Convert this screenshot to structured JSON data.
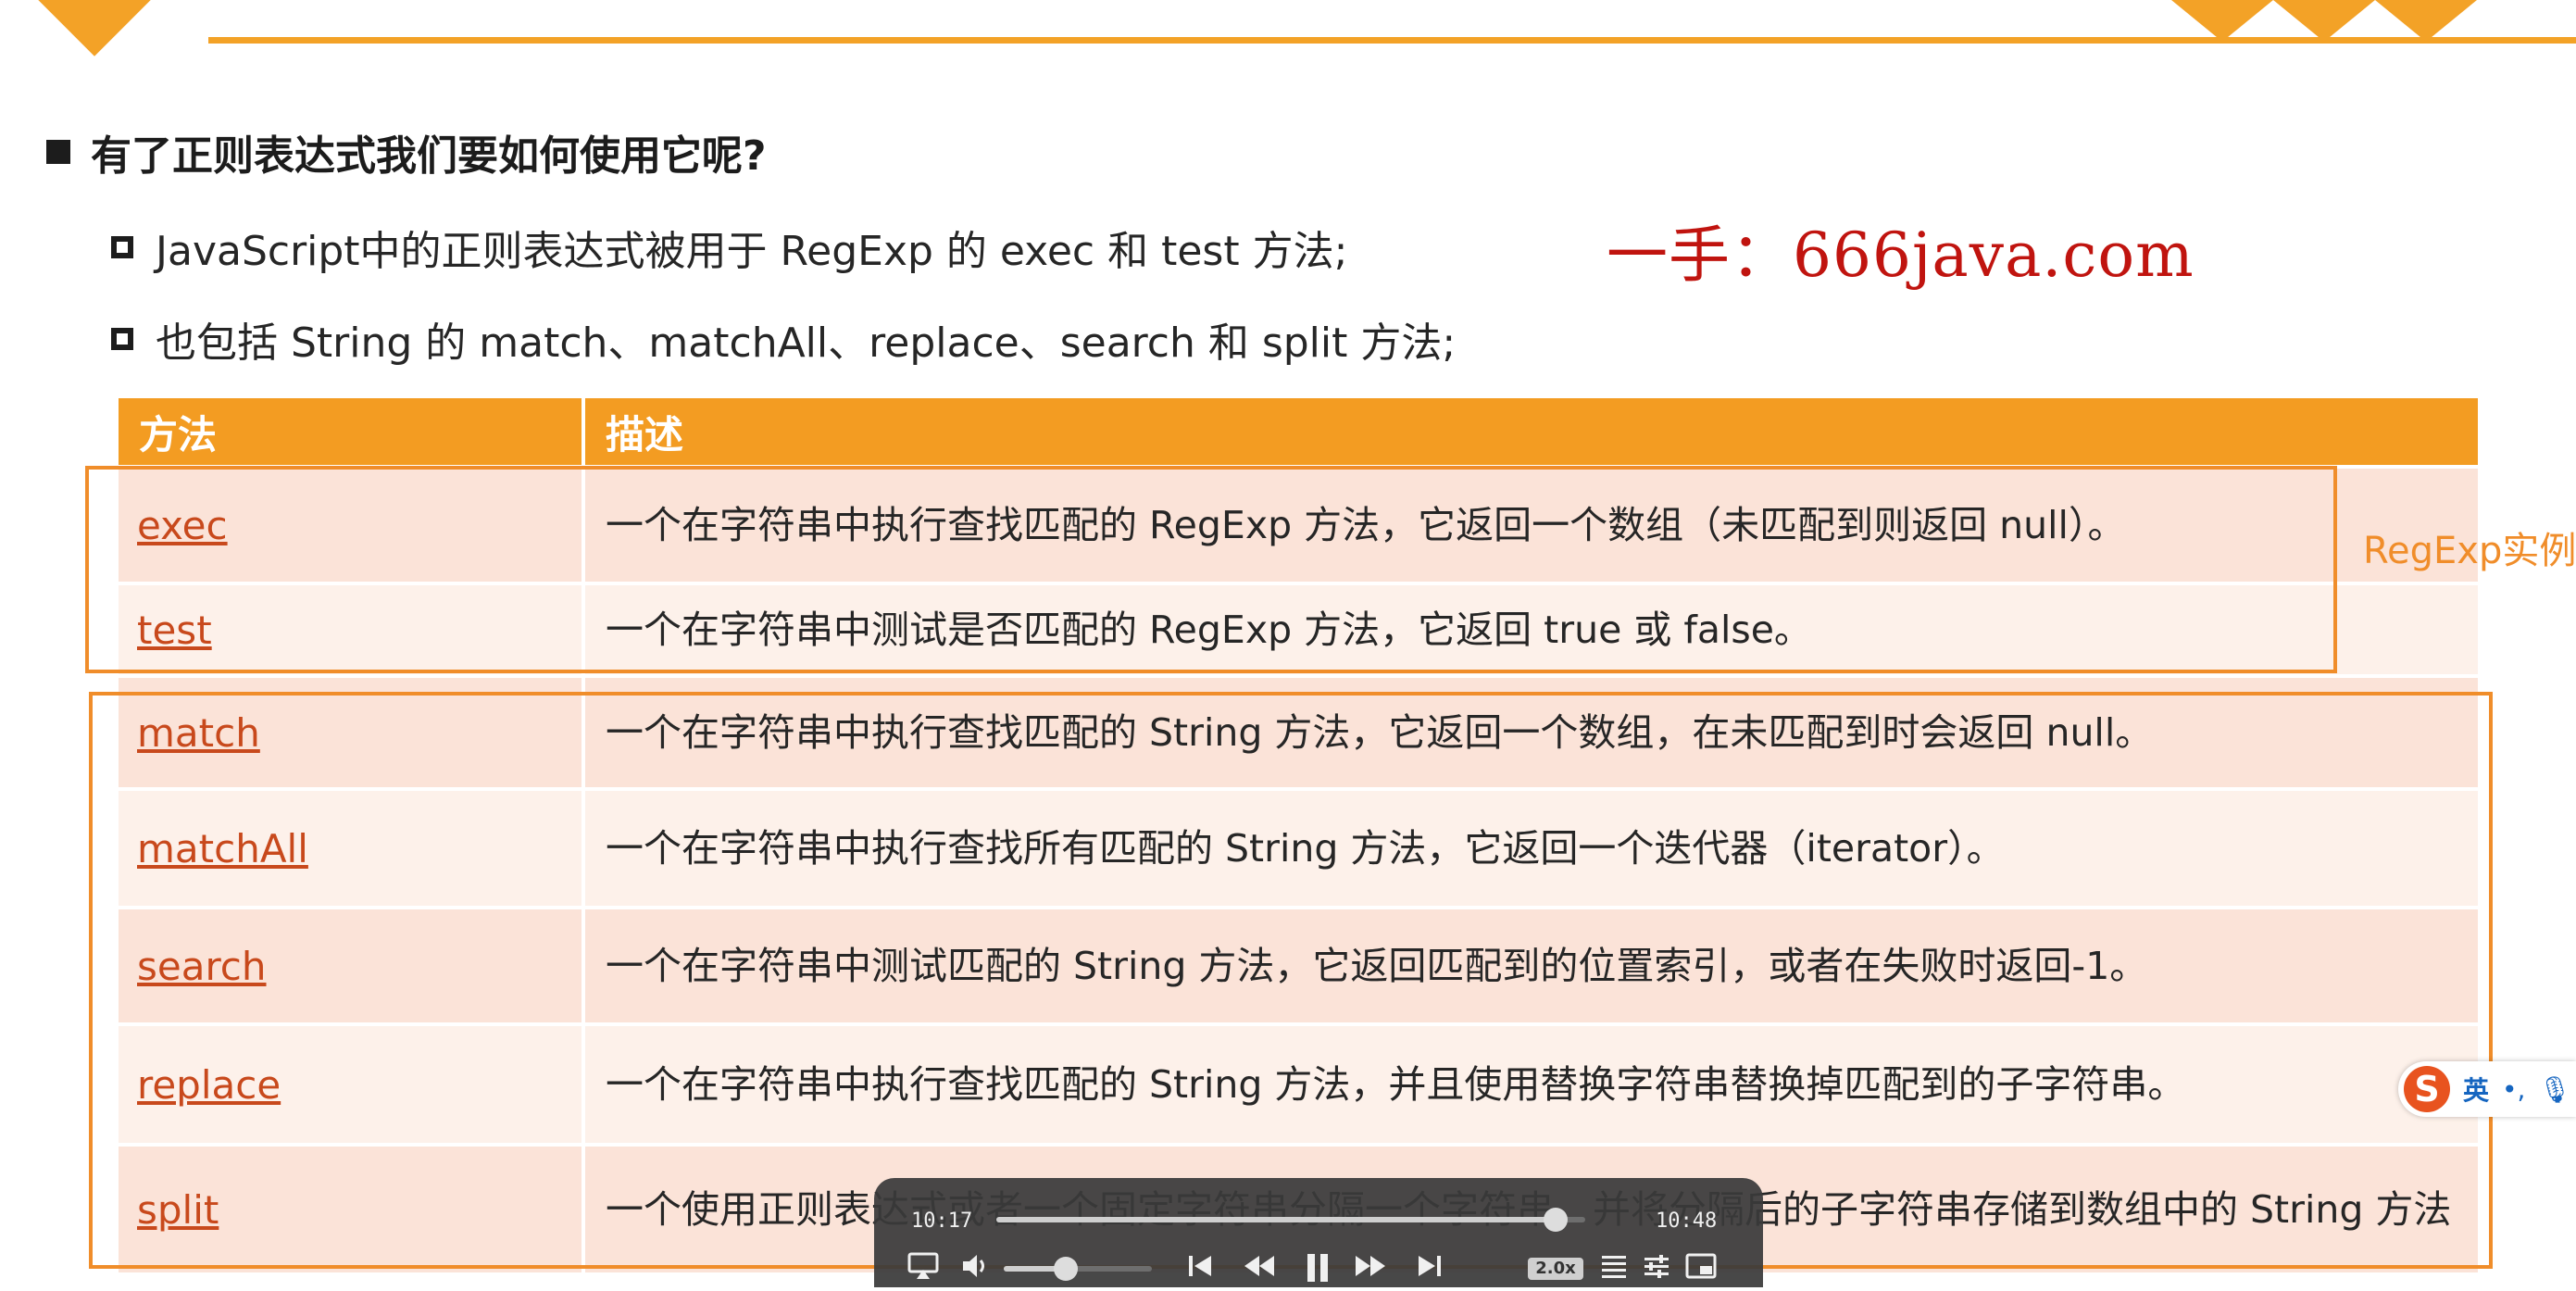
{
  "slide": {
    "heading": "有了正则表达式我们要如何使用它呢?",
    "bullets": [
      "JavaScript中的正则表达式被用于 RegExp 的 exec 和 test 方法;",
      "也包括 String 的 match、matchAll、replace、search 和 split 方法;"
    ],
    "watermark": "一手：666java.com",
    "side_note": "RegExp实例方"
  },
  "table": {
    "headers": [
      "方法",
      "描述"
    ],
    "rows": [
      {
        "method": "exec",
        "desc": "一个在字符串中执行查找匹配的 RegExp 方法，它返回一个数组（未匹配到则返回 null）。"
      },
      {
        "method": "test",
        "desc": "一个在字符串中测试是否匹配的 RegExp 方法，它返回 true 或 false。"
      },
      {
        "method": "match",
        "desc": "一个在字符串中执行查找匹配的 String 方法，它返回一个数组，在未匹配到时会返回 null。"
      },
      {
        "method": "matchAll",
        "desc": "一个在字符串中执行查找所有匹配的 String 方法，它返回一个迭代器（iterator）。"
      },
      {
        "method": "search",
        "desc": "一个在字符串中测试匹配的 String 方法，它返回匹配到的位置索引，或者在失败时返回-1。"
      },
      {
        "method": "replace",
        "desc": "一个在字符串中执行查找匹配的 String 方法，并且使用替换字符串替换掉匹配到的子字符串。"
      },
      {
        "method": "split",
        "desc": "一个使用正则表达式或者一个固定字符串分隔一个字符串，并将分隔后的子字符串存储到数组中的 String 方法"
      }
    ]
  },
  "ime": {
    "logo": "S",
    "lang": "英",
    "icons": [
      "punctuation-icon",
      "microphone-icon"
    ],
    "punct": "•,",
    "mic": "🎙"
  },
  "player": {
    "current_time": "10:17",
    "total_time": "10:48",
    "progress": 0.95,
    "volume": 0.42,
    "speed": "2.0x",
    "accent": "#cfcfcf"
  }
}
